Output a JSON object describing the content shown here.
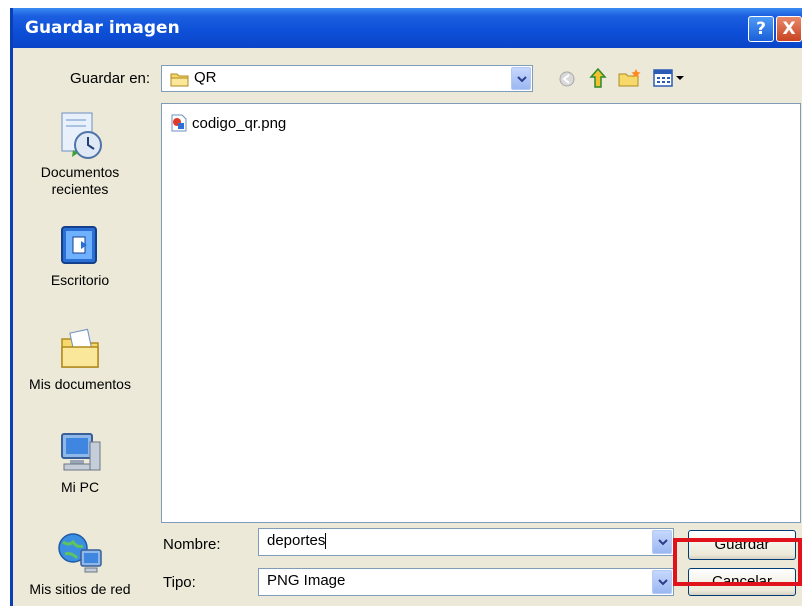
{
  "dialog": {
    "title": "Guardar imagen",
    "help_label": "?",
    "close_label": "X"
  },
  "location": {
    "label": "Guardar en:",
    "value": "QR"
  },
  "places": [
    {
      "label_line1": "Documentos",
      "label_line2": "recientes",
      "icon": "recent-documents-icon"
    },
    {
      "label_line1": "Escritorio",
      "label_line2": "",
      "icon": "desktop-icon"
    },
    {
      "label_line1": "Mis documentos",
      "label_line2": "",
      "icon": "my-documents-icon"
    },
    {
      "label_line1": "Mi PC",
      "label_line2": "",
      "icon": "my-computer-icon"
    },
    {
      "label_line1": "Mis sitios de red",
      "label_line2": "",
      "icon": "network-places-icon"
    }
  ],
  "files": [
    {
      "name": "codigo_qr.png",
      "icon": "png-file-icon"
    }
  ],
  "filename": {
    "label": "Nombre:",
    "value": "deportes"
  },
  "filetype": {
    "label": "Tipo:",
    "value": "PNG Image"
  },
  "buttons": {
    "save": "Guardar",
    "cancel": "Cancelar"
  },
  "colors": {
    "titlebar": "#0d4fd7",
    "dialog_bg": "#ece9d8",
    "highlight": "#e0121c"
  }
}
